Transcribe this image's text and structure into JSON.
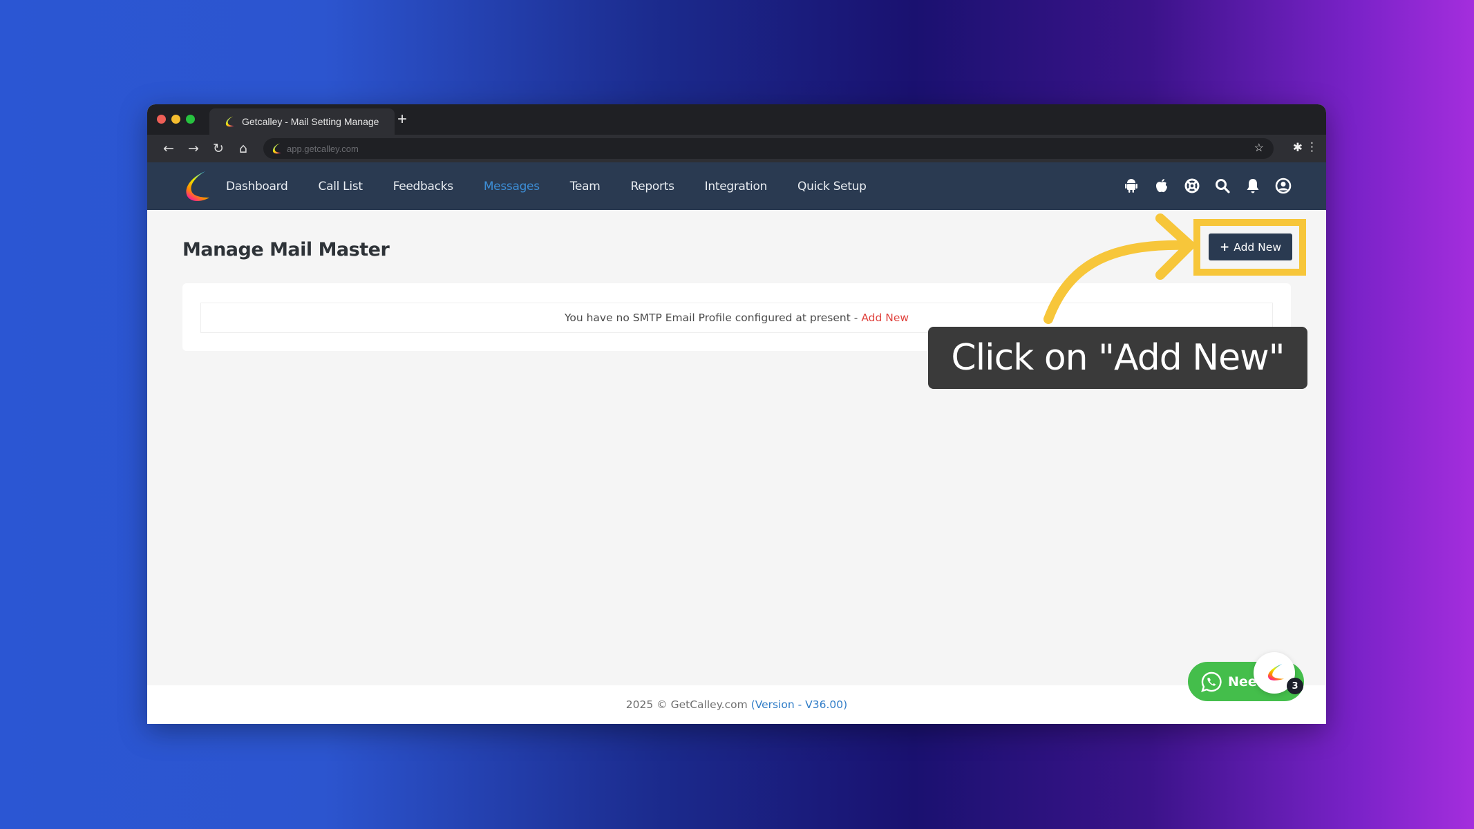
{
  "browser": {
    "tab_title": "Getcalley - Mail Setting Manage",
    "new_tab_label": "+",
    "url": "app.getcalley.com",
    "nav_icons": [
      "back-arrow-icon",
      "forward-arrow-icon",
      "reload-icon",
      "home-icon"
    ],
    "toolbar_icons": [
      "bookmark-star-icon",
      "extensions-puzzle-icon",
      "kebab-menu-icon"
    ]
  },
  "app_nav": {
    "brand": "GetCalley",
    "items": [
      {
        "label": "Dashboard",
        "active": false
      },
      {
        "label": "Call List",
        "active": false
      },
      {
        "label": "Feedbacks",
        "active": false
      },
      {
        "label": "Messages",
        "active": true
      },
      {
        "label": "Team",
        "active": false
      },
      {
        "label": "Reports",
        "active": false
      },
      {
        "label": "Integration",
        "active": false
      },
      {
        "label": "Quick Setup",
        "active": false
      }
    ],
    "right_icons": [
      "android-icon",
      "apple-icon",
      "support-lifering-icon",
      "search-icon",
      "bell-icon",
      "user-circle-icon"
    ]
  },
  "page": {
    "title": "Manage Mail Master",
    "add_button_label": "Add New",
    "empty_message": "You have no SMTP Email Profile configured at present -",
    "empty_link": "Add New"
  },
  "footer": {
    "copyright": "2025 © GetCalley.com",
    "version": "(Version - V36.00)"
  },
  "annotation": {
    "callout_text": "Click on \"Add New\""
  },
  "widgets": {
    "whatsapp_label": "Need",
    "chat_badge_count": "3"
  },
  "colors": {
    "nav_bg": "#2a3a51",
    "active_nav": "#3d8ed6",
    "highlight": "#f7c63a",
    "link_red": "#e0443f",
    "whatsapp_green": "#44be4b"
  }
}
